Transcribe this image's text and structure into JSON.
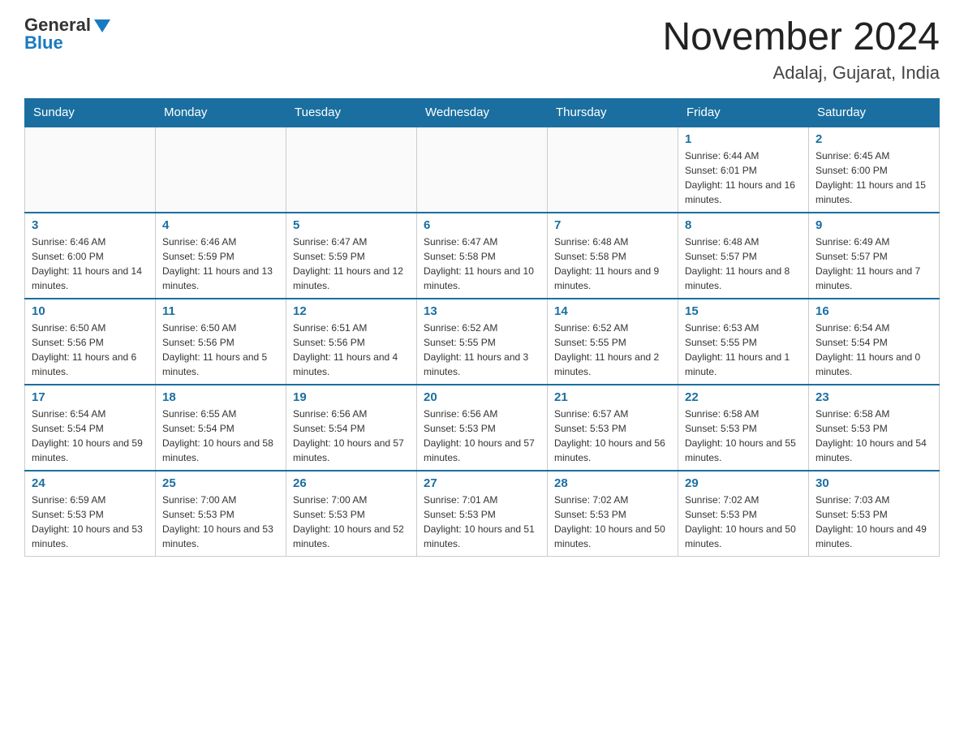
{
  "header": {
    "logo_general": "General",
    "logo_blue": "Blue",
    "month_title": "November 2024",
    "location": "Adalaj, Gujarat, India"
  },
  "days_of_week": [
    "Sunday",
    "Monday",
    "Tuesday",
    "Wednesday",
    "Thursday",
    "Friday",
    "Saturday"
  ],
  "weeks": [
    {
      "days": [
        {
          "date": "",
          "sunrise": "",
          "sunset": "",
          "daylight": ""
        },
        {
          "date": "",
          "sunrise": "",
          "sunset": "",
          "daylight": ""
        },
        {
          "date": "",
          "sunrise": "",
          "sunset": "",
          "daylight": ""
        },
        {
          "date": "",
          "sunrise": "",
          "sunset": "",
          "daylight": ""
        },
        {
          "date": "",
          "sunrise": "",
          "sunset": "",
          "daylight": ""
        },
        {
          "date": "1",
          "sunrise": "Sunrise: 6:44 AM",
          "sunset": "Sunset: 6:01 PM",
          "daylight": "Daylight: 11 hours and 16 minutes."
        },
        {
          "date": "2",
          "sunrise": "Sunrise: 6:45 AM",
          "sunset": "Sunset: 6:00 PM",
          "daylight": "Daylight: 11 hours and 15 minutes."
        }
      ]
    },
    {
      "days": [
        {
          "date": "3",
          "sunrise": "Sunrise: 6:46 AM",
          "sunset": "Sunset: 6:00 PM",
          "daylight": "Daylight: 11 hours and 14 minutes."
        },
        {
          "date": "4",
          "sunrise": "Sunrise: 6:46 AM",
          "sunset": "Sunset: 5:59 PM",
          "daylight": "Daylight: 11 hours and 13 minutes."
        },
        {
          "date": "5",
          "sunrise": "Sunrise: 6:47 AM",
          "sunset": "Sunset: 5:59 PM",
          "daylight": "Daylight: 11 hours and 12 minutes."
        },
        {
          "date": "6",
          "sunrise": "Sunrise: 6:47 AM",
          "sunset": "Sunset: 5:58 PM",
          "daylight": "Daylight: 11 hours and 10 minutes."
        },
        {
          "date": "7",
          "sunrise": "Sunrise: 6:48 AM",
          "sunset": "Sunset: 5:58 PM",
          "daylight": "Daylight: 11 hours and 9 minutes."
        },
        {
          "date": "8",
          "sunrise": "Sunrise: 6:48 AM",
          "sunset": "Sunset: 5:57 PM",
          "daylight": "Daylight: 11 hours and 8 minutes."
        },
        {
          "date": "9",
          "sunrise": "Sunrise: 6:49 AM",
          "sunset": "Sunset: 5:57 PM",
          "daylight": "Daylight: 11 hours and 7 minutes."
        }
      ]
    },
    {
      "days": [
        {
          "date": "10",
          "sunrise": "Sunrise: 6:50 AM",
          "sunset": "Sunset: 5:56 PM",
          "daylight": "Daylight: 11 hours and 6 minutes."
        },
        {
          "date": "11",
          "sunrise": "Sunrise: 6:50 AM",
          "sunset": "Sunset: 5:56 PM",
          "daylight": "Daylight: 11 hours and 5 minutes."
        },
        {
          "date": "12",
          "sunrise": "Sunrise: 6:51 AM",
          "sunset": "Sunset: 5:56 PM",
          "daylight": "Daylight: 11 hours and 4 minutes."
        },
        {
          "date": "13",
          "sunrise": "Sunrise: 6:52 AM",
          "sunset": "Sunset: 5:55 PM",
          "daylight": "Daylight: 11 hours and 3 minutes."
        },
        {
          "date": "14",
          "sunrise": "Sunrise: 6:52 AM",
          "sunset": "Sunset: 5:55 PM",
          "daylight": "Daylight: 11 hours and 2 minutes."
        },
        {
          "date": "15",
          "sunrise": "Sunrise: 6:53 AM",
          "sunset": "Sunset: 5:55 PM",
          "daylight": "Daylight: 11 hours and 1 minute."
        },
        {
          "date": "16",
          "sunrise": "Sunrise: 6:54 AM",
          "sunset": "Sunset: 5:54 PM",
          "daylight": "Daylight: 11 hours and 0 minutes."
        }
      ]
    },
    {
      "days": [
        {
          "date": "17",
          "sunrise": "Sunrise: 6:54 AM",
          "sunset": "Sunset: 5:54 PM",
          "daylight": "Daylight: 10 hours and 59 minutes."
        },
        {
          "date": "18",
          "sunrise": "Sunrise: 6:55 AM",
          "sunset": "Sunset: 5:54 PM",
          "daylight": "Daylight: 10 hours and 58 minutes."
        },
        {
          "date": "19",
          "sunrise": "Sunrise: 6:56 AM",
          "sunset": "Sunset: 5:54 PM",
          "daylight": "Daylight: 10 hours and 57 minutes."
        },
        {
          "date": "20",
          "sunrise": "Sunrise: 6:56 AM",
          "sunset": "Sunset: 5:53 PM",
          "daylight": "Daylight: 10 hours and 57 minutes."
        },
        {
          "date": "21",
          "sunrise": "Sunrise: 6:57 AM",
          "sunset": "Sunset: 5:53 PM",
          "daylight": "Daylight: 10 hours and 56 minutes."
        },
        {
          "date": "22",
          "sunrise": "Sunrise: 6:58 AM",
          "sunset": "Sunset: 5:53 PM",
          "daylight": "Daylight: 10 hours and 55 minutes."
        },
        {
          "date": "23",
          "sunrise": "Sunrise: 6:58 AM",
          "sunset": "Sunset: 5:53 PM",
          "daylight": "Daylight: 10 hours and 54 minutes."
        }
      ]
    },
    {
      "days": [
        {
          "date": "24",
          "sunrise": "Sunrise: 6:59 AM",
          "sunset": "Sunset: 5:53 PM",
          "daylight": "Daylight: 10 hours and 53 minutes."
        },
        {
          "date": "25",
          "sunrise": "Sunrise: 7:00 AM",
          "sunset": "Sunset: 5:53 PM",
          "daylight": "Daylight: 10 hours and 53 minutes."
        },
        {
          "date": "26",
          "sunrise": "Sunrise: 7:00 AM",
          "sunset": "Sunset: 5:53 PM",
          "daylight": "Daylight: 10 hours and 52 minutes."
        },
        {
          "date": "27",
          "sunrise": "Sunrise: 7:01 AM",
          "sunset": "Sunset: 5:53 PM",
          "daylight": "Daylight: 10 hours and 51 minutes."
        },
        {
          "date": "28",
          "sunrise": "Sunrise: 7:02 AM",
          "sunset": "Sunset: 5:53 PM",
          "daylight": "Daylight: 10 hours and 50 minutes."
        },
        {
          "date": "29",
          "sunrise": "Sunrise: 7:02 AM",
          "sunset": "Sunset: 5:53 PM",
          "daylight": "Daylight: 10 hours and 50 minutes."
        },
        {
          "date": "30",
          "sunrise": "Sunrise: 7:03 AM",
          "sunset": "Sunset: 5:53 PM",
          "daylight": "Daylight: 10 hours and 49 minutes."
        }
      ]
    }
  ]
}
